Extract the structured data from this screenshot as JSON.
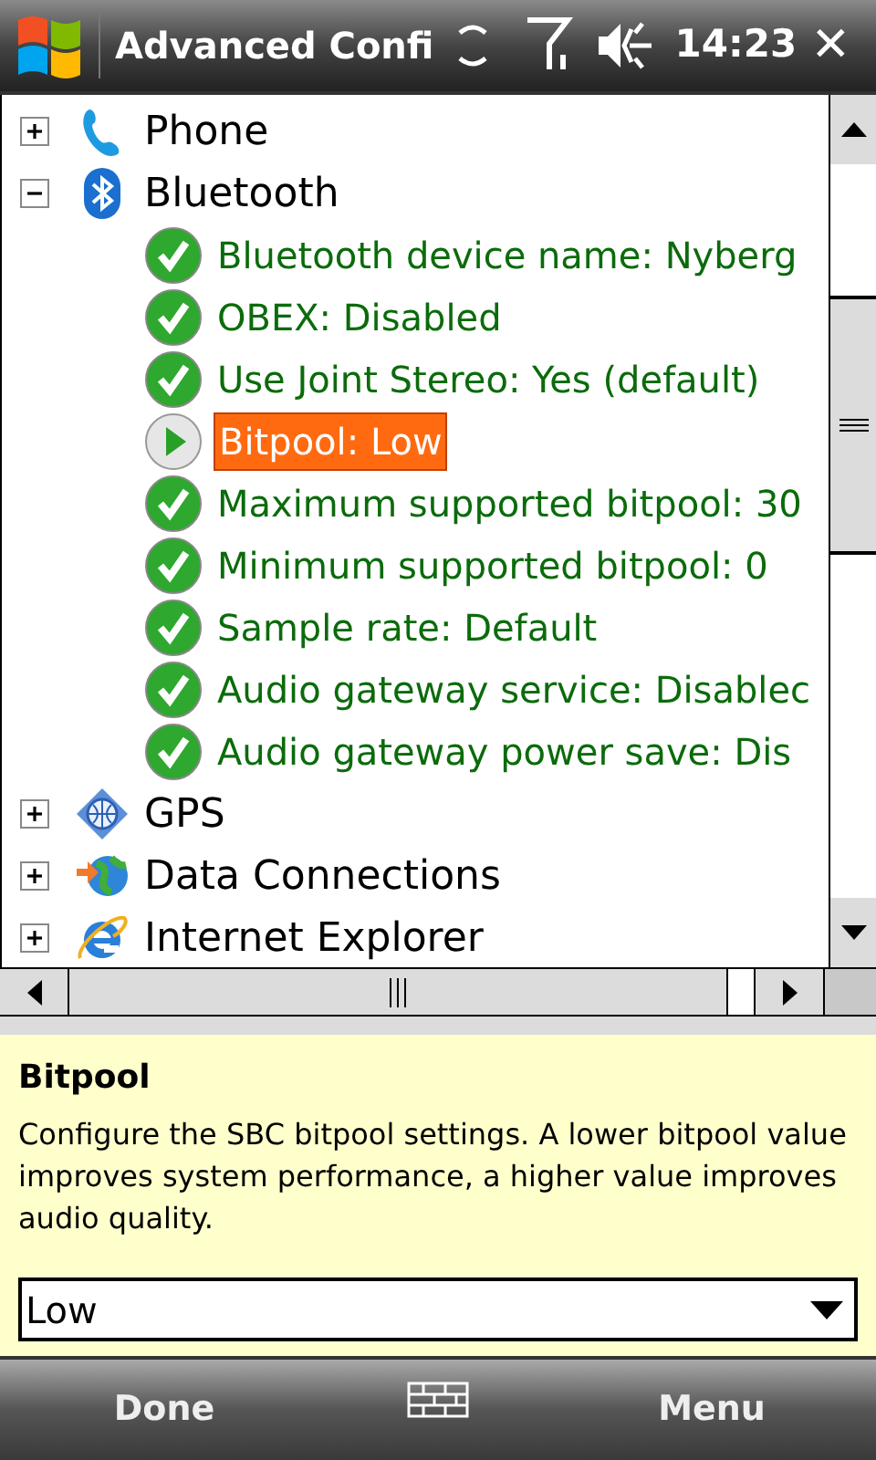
{
  "title_bar": {
    "title": "Advanced Confi",
    "time": "14:23",
    "close": "✕"
  },
  "tree": [
    {
      "label": "Phone",
      "expanded": false
    },
    {
      "label": "Bluetooth",
      "expanded": true,
      "children": [
        {
          "label": "Bluetooth device name: Nyberg",
          "selected": false
        },
        {
          "label": "OBEX: Disabled",
          "selected": false
        },
        {
          "label": "Use Joint Stereo: Yes (default)",
          "selected": false
        },
        {
          "label": "Bitpool: Low",
          "selected": true
        },
        {
          "label": "Maximum supported bitpool: 30",
          "selected": false
        },
        {
          "label": "Minimum supported bitpool: 0",
          "selected": false
        },
        {
          "label": "Sample rate: Default",
          "selected": false
        },
        {
          "label": "Audio gateway service: Disablec",
          "selected": false
        },
        {
          "label": "Audio gateway power save: Dis",
          "selected": false
        }
      ]
    },
    {
      "label": "GPS",
      "expanded": false
    },
    {
      "label": "Data Connections",
      "expanded": false
    },
    {
      "label": "Internet Explorer",
      "expanded": false
    }
  ],
  "details": {
    "heading": "Bitpool",
    "description": "Configure the SBC bitpool settings. A lower bitpool value improves system performance, a higher value improves audio quality.",
    "value": "Low"
  },
  "softkeys": {
    "left": "Done",
    "right": "Menu"
  }
}
